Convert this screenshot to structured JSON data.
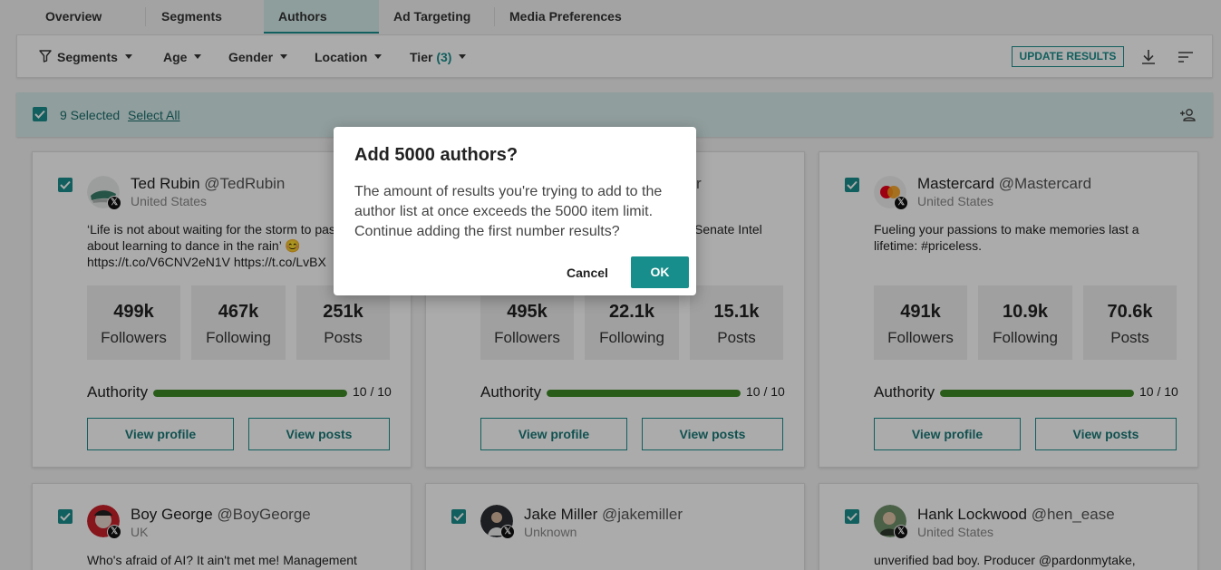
{
  "tabs": [
    "Overview",
    "Segments",
    "Authors",
    "Ad Targeting",
    "Media Preferences"
  ],
  "filters": {
    "segments": "Segments",
    "age": "Age",
    "gender": "Gender",
    "location": "Location",
    "tier": "Tier",
    "tier_count": "(3)",
    "update_results": "UPDATE RESULTS"
  },
  "selection": {
    "count_label": "9 Selected",
    "select_all": "Select All"
  },
  "cards": [
    {
      "name": "Ted Rubin",
      "handle": "@TedRubin",
      "location": "United States",
      "bio": "‘Life is not about waiting for the storm to pass, it’s about learning to dance in the rain’ 😊 https://t.co/V6CNV2eN1V https://t.co/LvBX",
      "followers": "499k",
      "following": "467k",
      "posts": "251k",
      "authority": "10 / 10",
      "authority_fraction": 1.0
    },
    {
      "name": "",
      "handle": "r",
      "location": "",
      "bio": "Senate Intel",
      "followers": "495k",
      "following": "22.1k",
      "posts": "15.1k",
      "authority": "10 / 10",
      "authority_fraction": 1.0
    },
    {
      "name": "Mastercard",
      "handle": "@Mastercard",
      "location": "United States",
      "bio": "Fueling your passions to make memories last a lifetime: #priceless.",
      "followers": "491k",
      "following": "10.9k",
      "posts": "70.6k",
      "authority": "10 / 10",
      "authority_fraction": 1.0
    },
    {
      "name": "Boy George",
      "handle": "@BoyGeorge",
      "location": "UK",
      "bio": "Who's afraid of AI? It ain't met me! Management"
    },
    {
      "name": "Jake Miller",
      "handle": "@jakemiller",
      "location": "Unknown",
      "bio": ""
    },
    {
      "name": "Hank Lockwood",
      "handle": "@hen_ease",
      "location": "United States",
      "bio": "unverified bad boy. Producer @pardonmytake,"
    }
  ],
  "labels": {
    "followers": "Followers",
    "following": "Following",
    "posts": "Posts",
    "authority": "Authority",
    "view_profile": "View profile",
    "view_posts": "View posts"
  },
  "modal": {
    "title": "Add 5000 authors?",
    "body": "The amount of results you're trying to add to the author list at once exceeds the 5000 item limit. Continue adding the first number results?",
    "cancel": "Cancel",
    "ok": "OK"
  },
  "colors": {
    "accent": "#1a8e8c",
    "authority_bar": "#3c8a24",
    "selection_bar": "#d7ecea"
  }
}
